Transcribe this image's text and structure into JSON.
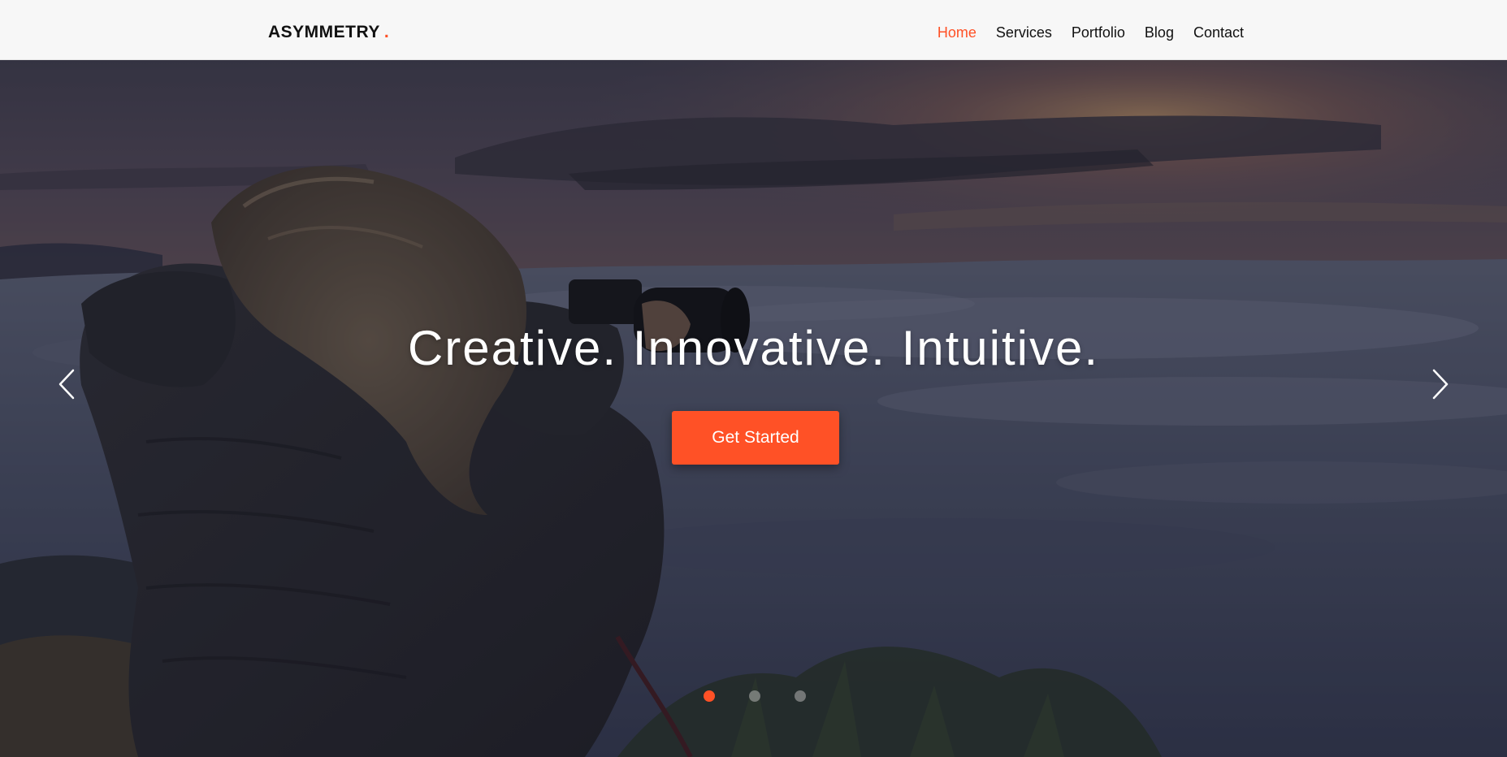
{
  "header": {
    "brand": "ASYMMETRY",
    "brand_dot": ".",
    "nav": [
      "Home",
      "Services",
      "Portfolio",
      "Blog",
      "Contact"
    ],
    "active_nav": "Home"
  },
  "hero": {
    "title": "Creative. Innovative. Intuitive.",
    "cta_label": "Get Started",
    "slides_count": 3,
    "active_slide": 1,
    "prev_icon": "chevron-left-icon",
    "next_icon": "chevron-right-icon"
  },
  "colors": {
    "accent": "#ff5126",
    "header_bg": "#f7f7f7",
    "text_dark": "#111111"
  }
}
